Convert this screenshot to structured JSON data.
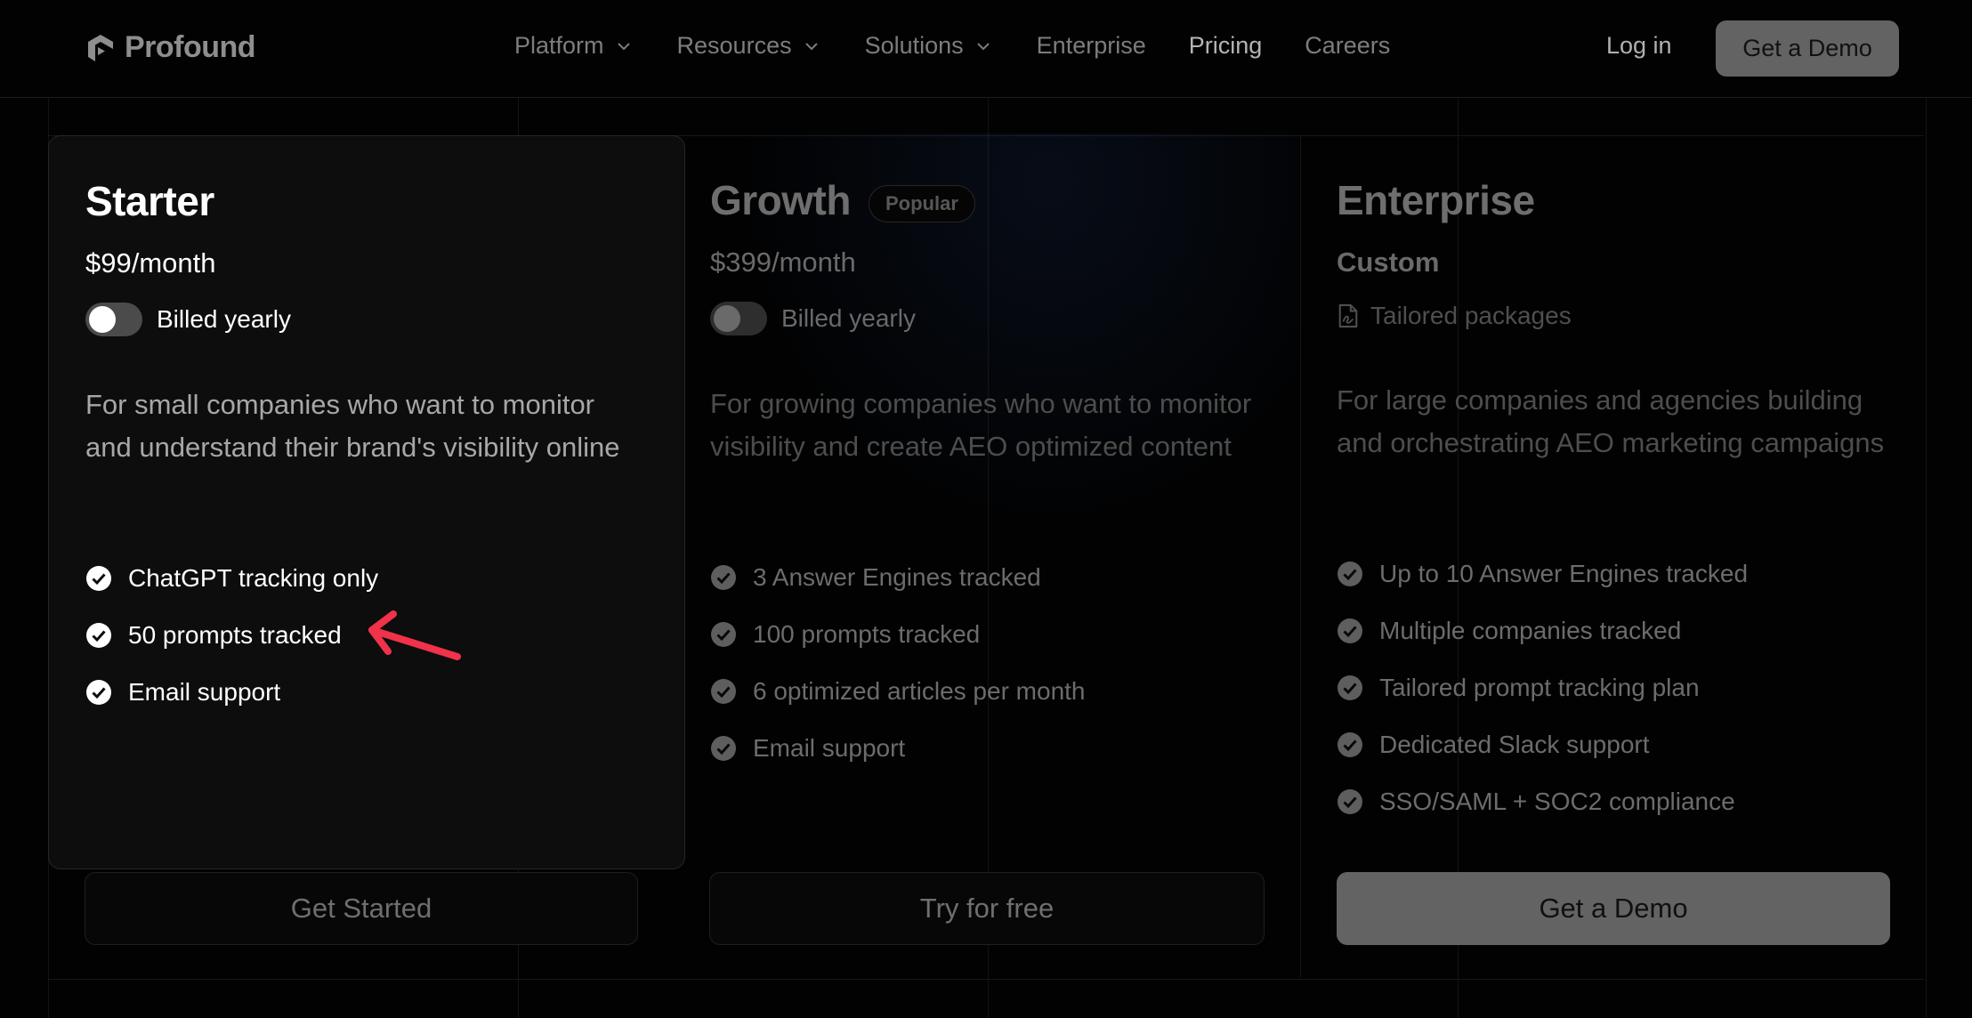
{
  "nav": {
    "logo_text": "Profound",
    "menu": [
      {
        "label": "Platform",
        "has_dropdown": true
      },
      {
        "label": "Resources",
        "has_dropdown": true
      },
      {
        "label": "Solutions",
        "has_dropdown": true
      },
      {
        "label": "Enterprise",
        "has_dropdown": false
      },
      {
        "label": "Pricing",
        "has_dropdown": false,
        "active": true
      },
      {
        "label": "Careers",
        "has_dropdown": false
      }
    ],
    "login_label": "Log in",
    "demo_label": "Get a Demo"
  },
  "plans": {
    "starter": {
      "title": "Starter",
      "price": "$99",
      "period": "/month",
      "toggle_label": "Billed yearly",
      "toggle_on": false,
      "description": "For small companies who want to monitor and understand their brand's visibility online",
      "features": [
        "ChatGPT tracking only",
        "50 prompts tracked",
        "Email support"
      ],
      "cta": "Get Started"
    },
    "growth": {
      "title": "Growth",
      "badge": "Popular",
      "price": "$399",
      "period": "/month",
      "toggle_label": "Billed yearly",
      "toggle_on": false,
      "description": "For growing companies who want to monitor visibility and create AEO optimized content",
      "features": [
        "3 Answer Engines tracked",
        "100 prompts tracked",
        "6 optimized articles per month",
        "Email support"
      ],
      "cta": "Try for free"
    },
    "enterprise": {
      "title": "Enterprise",
      "price": "Custom",
      "packages_label": "Tailored packages",
      "description": "For large companies and agencies building and orchestrating AEO marketing campaigns",
      "features": [
        "Up to 10 Answer Engines tracked",
        "Multiple companies tracked",
        "Tailored prompt tracking plan",
        "Dedicated Slack support",
        "SSO/SAML + SOC2 compliance"
      ],
      "cta": "Get a Demo"
    }
  },
  "annotation": {
    "icon": "red-arrow-icon",
    "color": "#f0324a"
  },
  "colors": {
    "background": "#020202",
    "card": "#0d0d0d",
    "accent_button": "#636363"
  }
}
